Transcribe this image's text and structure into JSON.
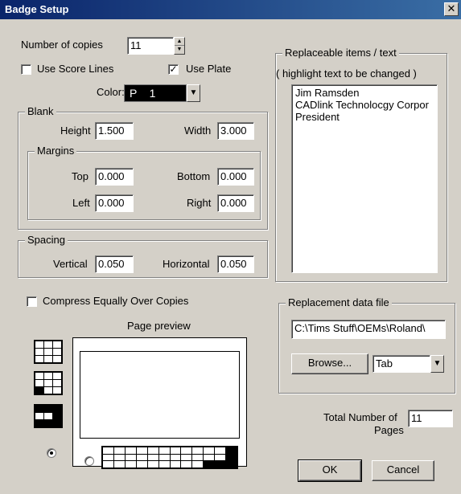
{
  "window": {
    "title": "Badge Setup",
    "close_glyph": "✕"
  },
  "copies": {
    "label": "Number of copies",
    "value": "11"
  },
  "use_score_lines": {
    "label": "Use Score Lines",
    "checked": false
  },
  "use_plate": {
    "label": "Use Plate",
    "checked": true
  },
  "color": {
    "label": "Color:",
    "value": "P    1"
  },
  "blank": {
    "legend": "Blank",
    "height_label": "Height",
    "height": "1.500",
    "width_label": "Width",
    "width": "3.000",
    "margins": {
      "legend": "Margins",
      "top_label": "Top",
      "top": "0.000",
      "bottom_label": "Bottom",
      "bottom": "0.000",
      "left_label": "Left",
      "left": "0.000",
      "right_label": "Right",
      "right": "0.000"
    }
  },
  "spacing": {
    "legend": "Spacing",
    "vertical_label": "Vertical",
    "vertical": "0.050",
    "horizontal_label": "Horizontal",
    "horizontal": "0.050"
  },
  "compress": {
    "label": "Compress Equally Over Copies",
    "checked": false
  },
  "preview": {
    "label": "Page preview",
    "layout": "vertical"
  },
  "replaceable": {
    "legend": "Replaceable items / text",
    "hint": "( highlight text to be changed )",
    "items": [
      "Jim Ramsden",
      "CADlink Technolocgy Corpor",
      "President"
    ]
  },
  "replacement": {
    "legend": "Replacement data file",
    "path": "C:\\Tims Stuff\\OEMs\\Roland\\",
    "browse_label": "Browse...",
    "delimiter": "Tab"
  },
  "total_pages": {
    "label_line1": "Total Number of",
    "label_line2": "Pages",
    "value": "11"
  },
  "buttons": {
    "ok": "OK",
    "cancel": "Cancel"
  }
}
